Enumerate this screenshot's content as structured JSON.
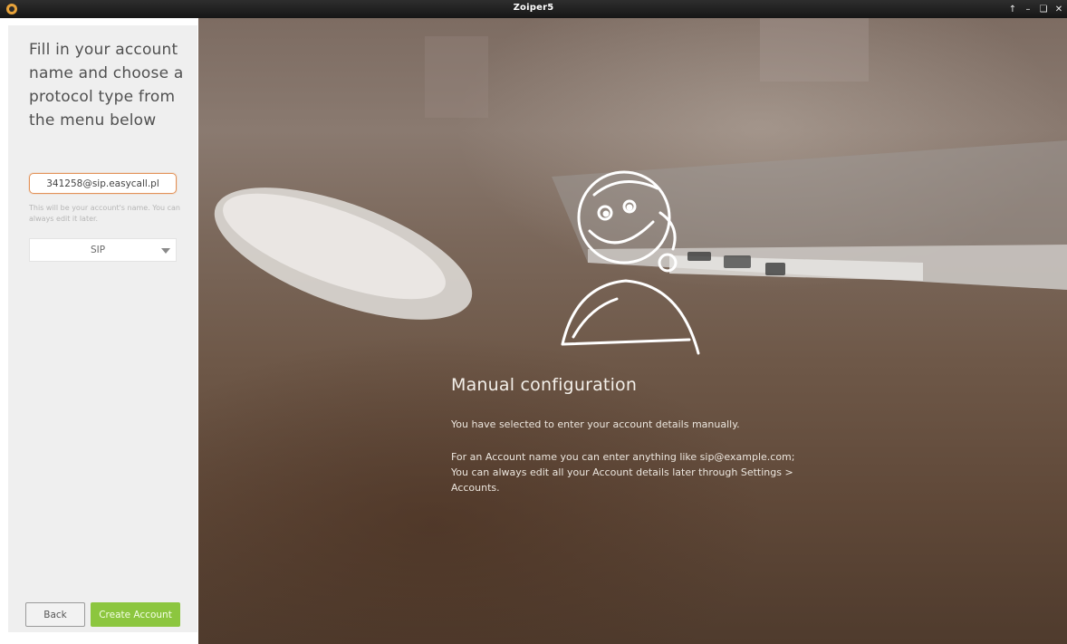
{
  "window": {
    "title": "Zoiper5",
    "app_icon": "zoiper-icon",
    "controls": [
      "arrow-up-icon",
      "minimize-icon",
      "restore-icon",
      "close-icon"
    ]
  },
  "sidebar": {
    "heading": "Fill in your account name and choose a protocol type from the menu below",
    "account_input": {
      "value": "341258@sip.easycall.pl",
      "placeholder": ""
    },
    "hint": "This will be your account's name. You can always edit it later.",
    "protocol_select": {
      "selected": "SIP"
    },
    "back_label": "Back",
    "create_label": "Create Account"
  },
  "info": {
    "title": "Manual configuration",
    "paragraph1": "You have selected to enter your account details manually.",
    "paragraph2": "For an Account name you can enter anything like sip@example.com; You can always edit all your Account details later through Settings > Accounts."
  },
  "colors": {
    "accent_green": "#8cc63f",
    "input_focus_border": "#e39258",
    "sidebar_bg": "#efefef",
    "titlebar_bg": "#1e1e1e"
  }
}
